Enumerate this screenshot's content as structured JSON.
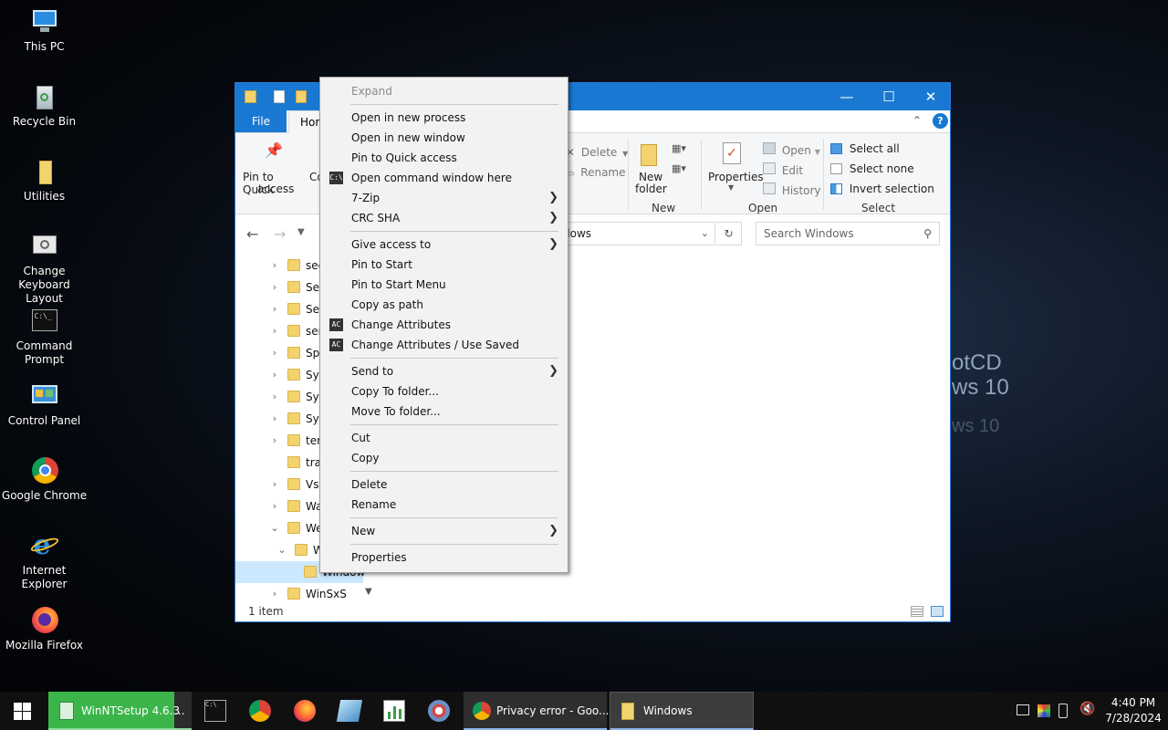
{
  "desktop": {
    "background_text": [
      "otCD",
      "ws 10",
      "ws 10"
    ],
    "icons": [
      {
        "label": "This PC",
        "icon": "computer-icon"
      },
      {
        "label": "Recycle Bin",
        "icon": "recycle-bin-icon"
      },
      {
        "label": "Utilities",
        "icon": "folder-icon"
      },
      {
        "label": "Change Keyboard Layout",
        "icon": "keyboard-settings-icon"
      },
      {
        "label": "Command Prompt",
        "icon": "terminal-icon"
      },
      {
        "label": "Control Panel",
        "icon": "control-panel-icon"
      },
      {
        "label": "Google Chrome",
        "icon": "chrome-icon"
      },
      {
        "label": "Internet Explorer",
        "icon": "ie-icon"
      },
      {
        "label": "Mozilla Firefox",
        "icon": "firefox-icon"
      }
    ]
  },
  "explorer": {
    "tabs": {
      "file": "File",
      "home": "Hom"
    },
    "ribbon": {
      "pin_line1": "Pin to Quick",
      "pin_line2": "access",
      "copy_partial": "Co",
      "delete": "Delete",
      "rename": "Rename",
      "new_folder_line1": "New",
      "new_folder_line2": "folder",
      "properties": "Properties",
      "open": "Open",
      "edit": "Edit",
      "history": "History",
      "select_all": "Select all",
      "select_none": "Select none",
      "invert_selection": "Invert selection",
      "group_new": "New",
      "group_open": "Open",
      "group_select": "Select"
    },
    "address_text": "dows",
    "search_placeholder": "Search Windows",
    "tree": [
      {
        "label": "sec",
        "expand": "collapsed"
      },
      {
        "label": "Ser",
        "expand": "collapsed"
      },
      {
        "label": "Ser",
        "expand": "collapsed"
      },
      {
        "label": "ser",
        "expand": "collapsed"
      },
      {
        "label": "Spe",
        "expand": "collapsed"
      },
      {
        "label": "Sys",
        "expand": "collapsed"
      },
      {
        "label": "Sys",
        "expand": "collapsed"
      },
      {
        "label": "Sys",
        "expand": "collapsed"
      },
      {
        "label": "ten",
        "expand": "collapsed"
      },
      {
        "label": "tra",
        "expand": "none"
      },
      {
        "label": "Vss",
        "expand": "collapsed"
      },
      {
        "label": "Wa",
        "expand": "collapsed"
      },
      {
        "label": "We",
        "expand": "expanded"
      },
      {
        "label": "W",
        "expand": "expanded"
      },
      {
        "label": "Window",
        "expand": "none"
      },
      {
        "label": "WinSxS",
        "expand": "collapsed"
      }
    ],
    "status": "1 item"
  },
  "context_menu": {
    "items": [
      {
        "label": "Expand",
        "disabled": true
      },
      {
        "sep": true
      },
      {
        "label": "Open in new process"
      },
      {
        "label": "Open in new window"
      },
      {
        "label": "Pin to Quick access"
      },
      {
        "label": "Open command window here",
        "icon": "terminal-icon"
      },
      {
        "label": "7-Zip",
        "submenu": true
      },
      {
        "label": "CRC SHA",
        "submenu": true
      },
      {
        "sep": true
      },
      {
        "label": "Give access to",
        "submenu": true
      },
      {
        "label": "Pin to Start"
      },
      {
        "label": "Pin to Start Menu"
      },
      {
        "label": "Copy as path"
      },
      {
        "label": "Change Attributes",
        "icon": "attributes-icon"
      },
      {
        "label": "Change Attributes / Use Saved",
        "icon": "attributes-icon"
      },
      {
        "sep": true
      },
      {
        "label": "Send to",
        "submenu": true
      },
      {
        "label": "Copy To folder..."
      },
      {
        "label": "Move To folder..."
      },
      {
        "sep": true
      },
      {
        "label": "Cut"
      },
      {
        "label": "Copy"
      },
      {
        "sep": true
      },
      {
        "label": "Delete"
      },
      {
        "label": "Rename"
      },
      {
        "sep": true
      },
      {
        "label": "New",
        "submenu": true
      },
      {
        "sep": true
      },
      {
        "label": "Properties"
      }
    ]
  },
  "taskbar": {
    "winntsetup": "WinNTSetup 4.6.3",
    "winntsetup_more": "...",
    "chrome_task": "Privacy error - Goo...",
    "explorer_task": "Windows",
    "time": "4:40 PM",
    "date": "7/28/2024"
  },
  "colors": {
    "accent": "#1979d2",
    "taskbar": "#101010",
    "winntsetup_green": "#3bb54a"
  }
}
